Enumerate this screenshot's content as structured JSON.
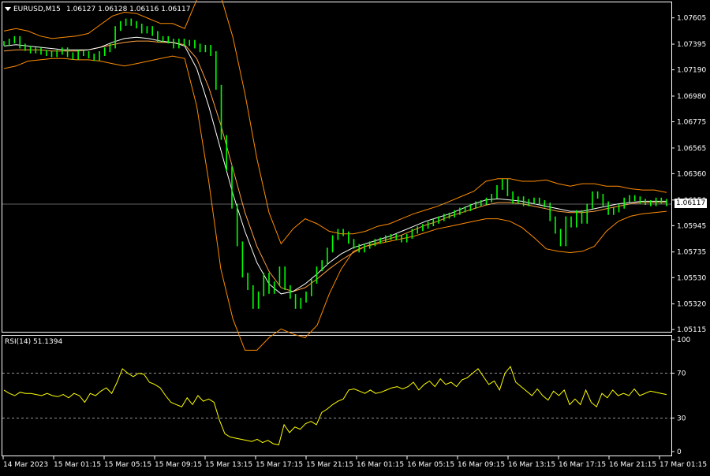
{
  "header": {
    "symbol_title": "EURUSD,M15",
    "ohlc": "1.06127 1.06128 1.06116 1.06117",
    "current_price": "1.06117"
  },
  "rsi_panel": {
    "label": "RSI(14) 51.1394",
    "value": 51.1394
  },
  "colors": {
    "background": "#000000",
    "candles": "#00ff00",
    "bollinger": "#ff8c00",
    "ma_white": "#ffffff",
    "ma_orange": "#ffa040",
    "rsi_line": "#ffff00",
    "grid_dashed": "#c8c8c8"
  },
  "chart_data": [
    {
      "type": "line",
      "title": "EURUSD,M15",
      "ylabel": "",
      "ylim": [
        1.0511,
        1.0771
      ],
      "y_ticks": [
        "1.07605",
        "1.07395",
        "1.07190",
        "1.06980",
        "1.06775",
        "1.06565",
        "1.06360",
        "1.06150",
        "1.05945",
        "1.05735",
        "1.05530",
        "1.05320",
        "1.05115"
      ],
      "x_ticks": [
        "14 Mar 2023",
        "15 Mar 01:15",
        "15 Mar 05:15",
        "15 Mar 09:15",
        "15 Mar 13:15",
        "15 Mar 17:15",
        "15 Mar 21:15",
        "16 Mar 01:15",
        "16 Mar 05:15",
        "16 Mar 09:15",
        "16 Mar 13:15",
        "16 Mar 17:15",
        "16 Mar 21:15",
        "17 Mar 01:15"
      ],
      "grid": false,
      "series": [
        {
          "name": "",
          "role": "close",
          "values": [
            1.074,
            1.0742,
            1.0744,
            1.0738,
            1.0736,
            1.0734,
            1.0735,
            1.0733,
            1.0732,
            1.0731,
            1.0733,
            1.0735,
            1.0731,
            1.0729,
            1.0733,
            1.0732,
            1.073,
            1.0728,
            1.0732,
            1.0735,
            1.0738,
            1.0752,
            1.0756,
            1.0758,
            1.0756,
            1.0754,
            1.075,
            1.0752,
            1.0748,
            1.0743,
            1.0744,
            1.0742,
            1.0738,
            1.0742,
            1.074,
            1.0741,
            1.0738,
            1.0735,
            1.0737,
            1.0732,
            1.0705,
            1.0665,
            1.064,
            1.061,
            1.058,
            1.0555,
            1.0545,
            1.053,
            1.054,
            1.0555,
            1.0542,
            1.0548,
            1.056,
            1.0545,
            1.0538,
            1.053,
            1.0535,
            1.054,
            1.055,
            1.056,
            1.0565,
            1.0575,
            1.0585,
            1.059,
            1.0588,
            1.0582,
            1.0578,
            1.0575,
            1.0578,
            1.058,
            1.0582,
            1.0583,
            1.0585,
            1.0586,
            1.0585,
            1.0583,
            1.0586,
            1.059,
            1.0592,
            1.0594,
            1.0596,
            1.0598,
            1.06,
            1.0602,
            1.0603,
            1.0605,
            1.0607,
            1.0608,
            1.061,
            1.0612,
            1.0613,
            1.0615,
            1.0618,
            1.0625,
            1.063,
            1.062,
            1.0614,
            1.0616,
            1.0612,
            1.0614,
            1.0615,
            1.0613,
            1.0611,
            1.06,
            1.059,
            1.058,
            1.06,
            1.0595,
            1.0605,
            1.0598,
            1.061,
            1.062,
            1.0618,
            1.0612,
            1.0605,
            1.0607,
            1.061,
            1.0615,
            1.0617,
            1.0616,
            1.0614,
            1.0613,
            1.0612,
            1.0615,
            1.0614,
            1.0612
          ]
        },
        {
          "name": "",
          "role": "moving-average-white",
          "values": [
            1.0738,
            1.0739,
            1.0738,
            1.0737,
            1.0736,
            1.0735,
            1.0735,
            1.0735,
            1.0737,
            1.0741,
            1.0744,
            1.0745,
            1.0744,
            1.0742,
            1.0741,
            1.0738,
            1.072,
            1.069,
            1.0655,
            1.062,
            1.059,
            1.0565,
            1.0548,
            1.054,
            1.0542,
            1.0548,
            1.0556,
            1.0565,
            1.0572,
            1.0577,
            1.058,
            1.0583,
            1.0586,
            1.059,
            1.0594,
            1.0598,
            1.0601,
            1.0604,
            1.0608,
            1.0612,
            1.0615,
            1.0616,
            1.0615,
            1.0614,
            1.0612,
            1.061,
            1.0608,
            1.0606,
            1.0606,
            1.0608,
            1.061,
            1.0612,
            1.0613,
            1.0614,
            1.0614,
            1.0614
          ]
        },
        {
          "name": "",
          "role": "moving-average-orange",
          "values": [
            1.0734,
            1.0735,
            1.0735,
            1.0735,
            1.0734,
            1.0734,
            1.0734,
            1.0735,
            1.0737,
            1.0739,
            1.0741,
            1.0742,
            1.0742,
            1.0741,
            1.0741,
            1.0739,
            1.0728,
            1.0705,
            1.0675,
            1.064,
            1.0605,
            1.0578,
            1.0558,
            1.0545,
            1.0542,
            1.0545,
            1.0552,
            1.056,
            1.0567,
            1.0573,
            1.0578,
            1.0581,
            1.0584,
            1.0587,
            1.0591,
            1.0595,
            1.0598,
            1.0602,
            1.0605,
            1.0608,
            1.0611,
            1.0613,
            1.0613,
            1.0612,
            1.061,
            1.0608,
            1.0606,
            1.0605,
            1.0605,
            1.0606,
            1.0608,
            1.061,
            1.0612,
            1.0613,
            1.0613,
            1.0613
          ]
        },
        {
          "name": "",
          "role": "bollinger-upper",
          "values": [
            1.075,
            1.0752,
            1.075,
            1.0746,
            1.0744,
            1.0745,
            1.0746,
            1.0748,
            1.0755,
            1.0762,
            1.0765,
            1.0764,
            1.076,
            1.0756,
            1.0756,
            1.0752,
            1.0775,
            1.079,
            1.0778,
            1.0745,
            1.07,
            1.0648,
            1.0605,
            1.058,
            1.0592,
            1.06,
            1.0596,
            1.059,
            1.0588,
            1.0588,
            1.059,
            1.0594,
            1.0596,
            1.06,
            1.0604,
            1.0607,
            1.061,
            1.0614,
            1.0618,
            1.0622,
            1.063,
            1.0632,
            1.0632,
            1.063,
            1.063,
            1.0631,
            1.0628,
            1.0626,
            1.0628,
            1.0628,
            1.0626,
            1.0626,
            1.0624,
            1.0623,
            1.0623,
            1.0621
          ]
        },
        {
          "name": "",
          "role": "bollinger-lower",
          "values": [
            1.072,
            1.0722,
            1.0726,
            1.0727,
            1.0728,
            1.0728,
            1.0727,
            1.0727,
            1.0726,
            1.0724,
            1.0722,
            1.0724,
            1.0726,
            1.0728,
            1.073,
            1.0728,
            1.069,
            1.063,
            1.056,
            1.052,
            1.0495,
            1.0495,
            1.0505,
            1.0512,
            1.0508,
            1.0505,
            1.0515,
            1.054,
            1.056,
            1.0574,
            1.0578,
            1.058,
            1.0582,
            1.0584,
            1.0586,
            1.0589,
            1.0592,
            1.0594,
            1.0596,
            1.0598,
            1.06,
            1.06,
            1.0598,
            1.0593,
            1.0585,
            1.0576,
            1.0574,
            1.0573,
            1.0574,
            1.0578,
            1.059,
            1.0598,
            1.0602,
            1.0604,
            1.0605,
            1.0606
          ]
        }
      ]
    },
    {
      "type": "line",
      "title": "RSI(14) 51.1394",
      "ylim": [
        0,
        100
      ],
      "y_ticks": [
        "100",
        "70",
        "30",
        "0"
      ],
      "levels": [
        70,
        30
      ],
      "series": [
        {
          "name": "",
          "values": [
            55,
            52,
            50,
            53,
            52,
            52,
            51,
            50,
            52,
            50,
            49,
            51,
            48,
            52,
            50,
            44,
            52,
            50,
            54,
            57,
            52,
            62,
            74,
            70,
            67,
            70,
            69,
            62,
            60,
            57,
            50,
            44,
            42,
            40,
            48,
            42,
            50,
            45,
            47,
            44,
            28,
            16,
            13,
            12,
            11,
            10,
            9,
            11,
            8,
            10,
            7,
            6,
            24,
            17,
            22,
            20,
            25,
            27,
            24,
            35,
            38,
            42,
            45,
            47,
            55,
            56,
            54,
            52,
            55,
            52,
            53,
            55,
            57,
            58,
            56,
            58,
            62,
            55,
            60,
            63,
            58,
            65,
            60,
            62,
            58,
            64,
            66,
            70,
            74,
            67,
            60,
            63,
            55,
            70,
            76,
            62,
            58,
            54,
            50,
            56,
            50,
            46,
            54,
            50,
            55,
            42,
            47,
            42,
            55,
            44,
            40,
            52,
            48,
            55,
            50,
            52,
            50,
            56,
            50,
            52,
            54,
            53,
            52,
            51
          ]
        }
      ]
    }
  ]
}
